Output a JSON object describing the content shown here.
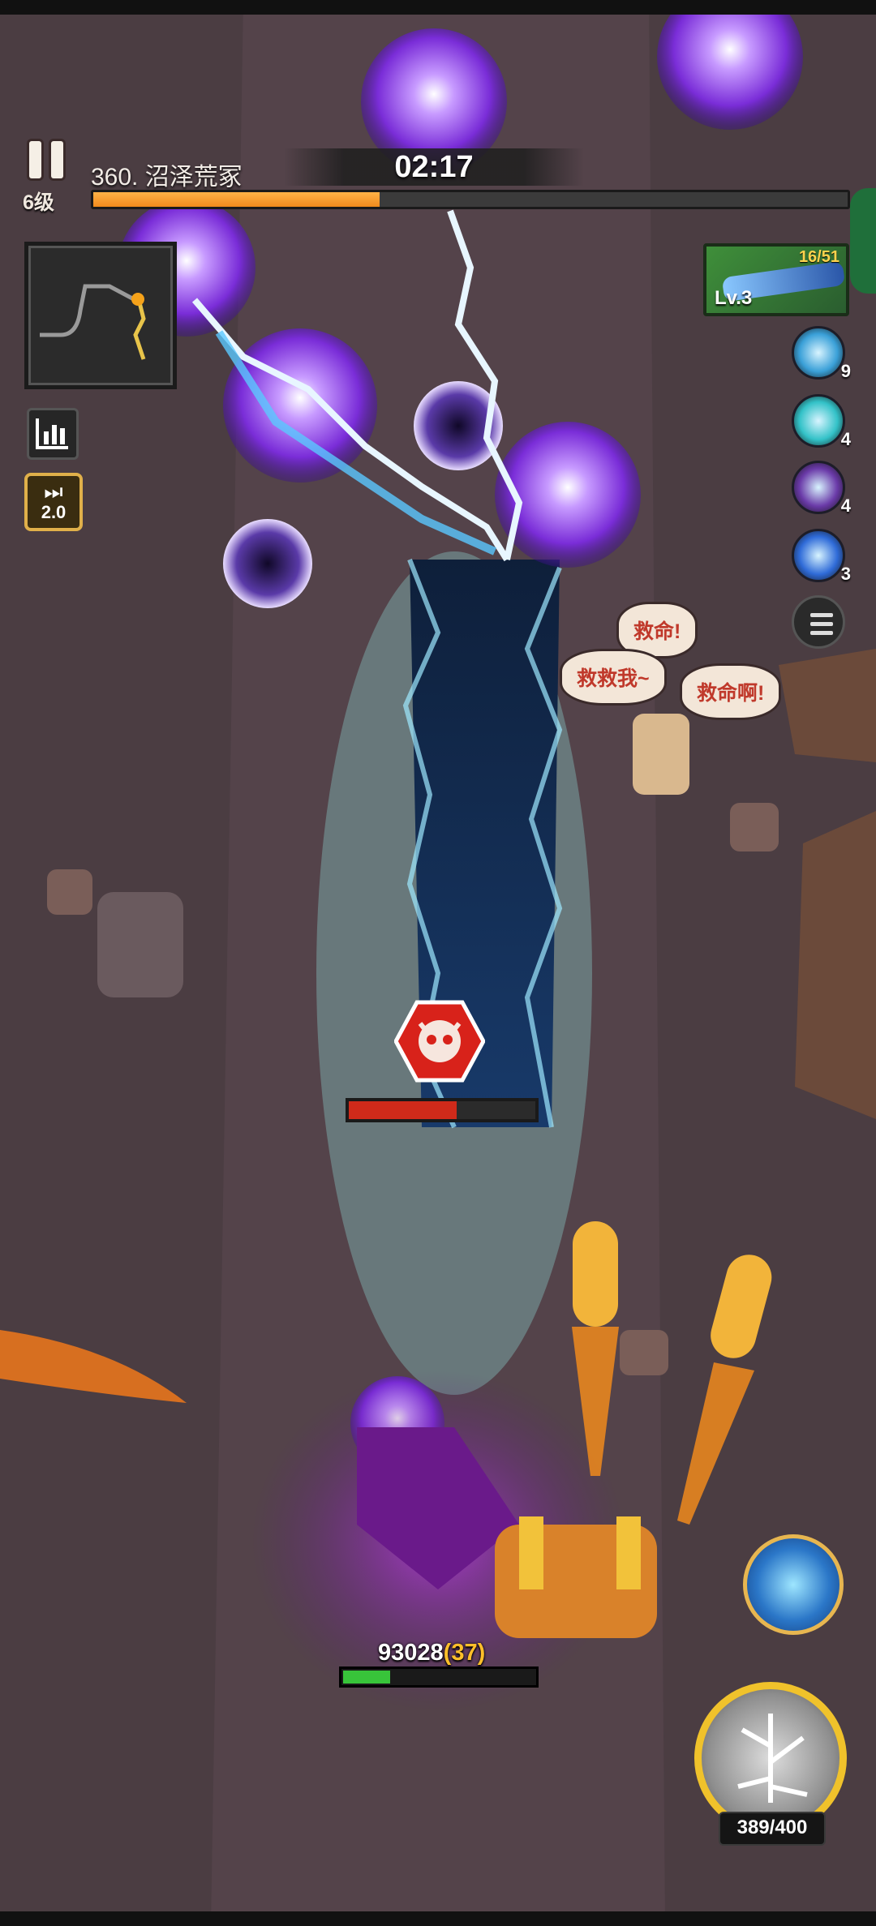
{
  "hud": {
    "player_level": "6级",
    "stage_name": "360. 沼泽荒冢",
    "timer": "02:17",
    "stage_progress": 0.38,
    "speed_multiplier": "2.0"
  },
  "weapon": {
    "level": "Lv.3",
    "pieces": "16/51"
  },
  "skills": [
    {
      "name": "water-orb-skill",
      "count": "9",
      "color": "#3aa0d8"
    },
    {
      "name": "frost-orb-skill",
      "count": "4",
      "color": "#33c2c8"
    },
    {
      "name": "void-orb-skill",
      "count": "4",
      "color": "#6a3aa8"
    },
    {
      "name": "lightning-skill",
      "count": "3",
      "color": "#2f6bd8"
    }
  ],
  "speech_bubbles": [
    {
      "text": "救命!"
    },
    {
      "text": "救救我~"
    },
    {
      "text": "救命啊!"
    }
  ],
  "boss": {
    "hp_fraction": 0.58
  },
  "player": {
    "power": "93028",
    "power_bonus": "(37)",
    "xp_fraction": 0.24
  },
  "main_skill": {
    "energy": "389/400"
  },
  "colors": {
    "progress": "#f08a1c",
    "boss_hp": "#d02a1a",
    "xp": "#38c43a",
    "skill_ring": "#f0c22b"
  }
}
